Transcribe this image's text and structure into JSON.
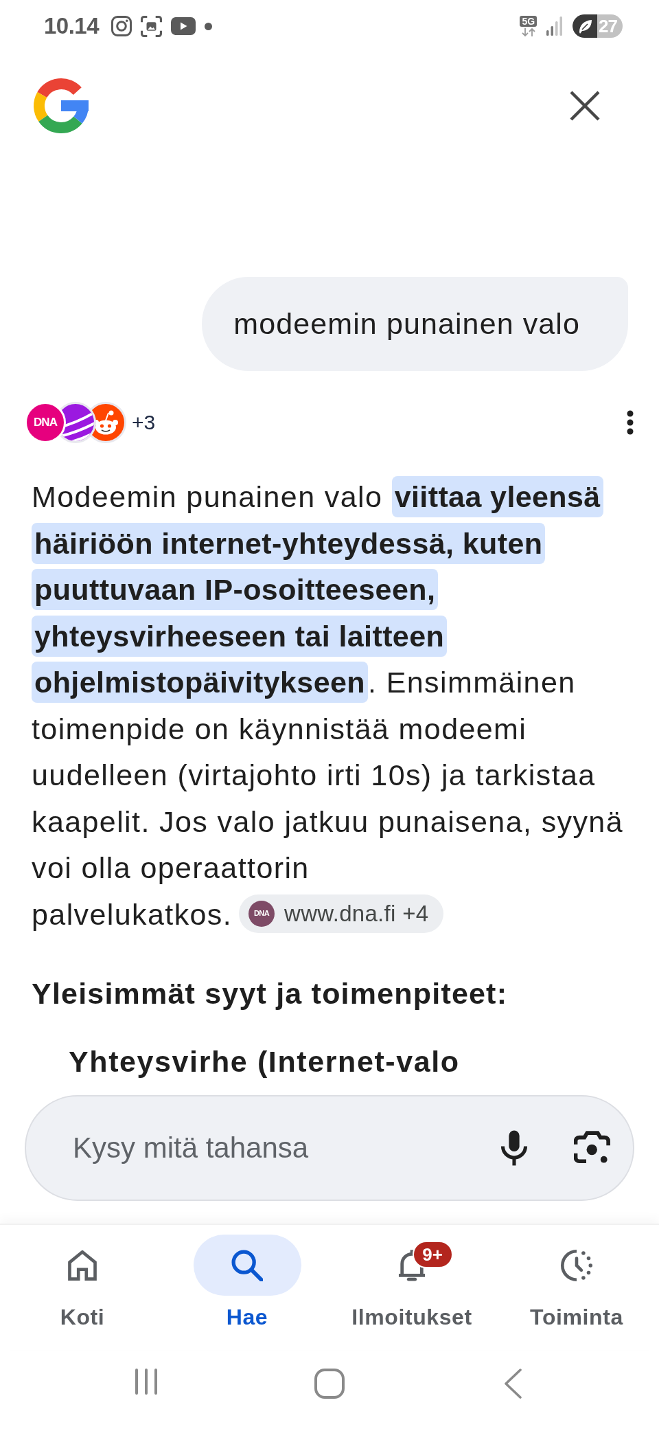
{
  "status_bar": {
    "time": "10.14",
    "network": "5G",
    "battery": "27"
  },
  "query": "modeemin punainen valo",
  "sources": {
    "logos": [
      {
        "kind": "dna",
        "label": "DNA"
      },
      {
        "kind": "telia"
      },
      {
        "kind": "reddit"
      }
    ],
    "more": "+3"
  },
  "answer": {
    "segments": [
      {
        "text": "Modeemin punainen valo ",
        "highlighted": false
      },
      {
        "text": "viittaa yleensä häiriöön internet-yhteydessä, kuten puuttuvaan IP-osoitteeseen, yhteysvirheeseen tai laitteen ohjelmistopäivitykseen",
        "highlighted": true
      },
      {
        "text": ". Ensimmäinen toimenpide on käynnistää modeemi uudelleen (virtajohto irti 10s) ja tarkistaa kaapelit. Jos valo jatkuu punaisena, syynä voi olla operaattorin palvelukatkos.",
        "highlighted": false
      }
    ],
    "citation": {
      "kind": "dna",
      "logo_label": "DNA",
      "label": "www.dna.fi +4"
    }
  },
  "heading": "Yleisimmät syyt ja toimenpiteet:",
  "list_items": [
    "Yhteysvirhe (Internet-valo"
  ],
  "ask_bar": {
    "placeholder": "Kysy mitä tahansa"
  },
  "nav": [
    {
      "kind": "home",
      "label": "Koti",
      "selected": false
    },
    {
      "kind": "search",
      "label": "Hae",
      "selected": true
    },
    {
      "kind": "notifications",
      "label": "Ilmoitukset",
      "selected": false,
      "badge": "9+"
    },
    {
      "kind": "activity",
      "label": "Toiminta",
      "selected": false
    }
  ]
}
